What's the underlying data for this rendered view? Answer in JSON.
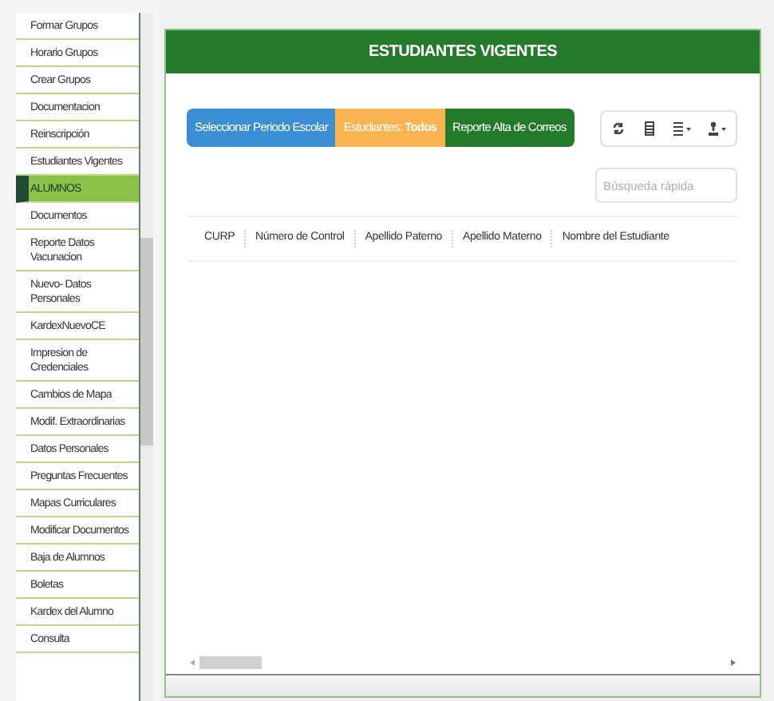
{
  "sidebar": {
    "items": [
      {
        "label": "Formar Grupos",
        "selected": false
      },
      {
        "label": "Horario Grupos",
        "selected": false
      },
      {
        "label": "Crear Grupos",
        "selected": false
      },
      {
        "label": "Documentacion",
        "selected": false
      },
      {
        "label": "Reinscripción",
        "selected": false
      },
      {
        "label": "Estudiantes Vigentes",
        "selected": false
      },
      {
        "label": "ALUMNOS",
        "selected": true
      },
      {
        "label": "Documentos",
        "selected": false
      },
      {
        "label": "Reporte Datos Vacunacion",
        "selected": false
      },
      {
        "label": "Nuevo- Datos Personales",
        "selected": false
      },
      {
        "label": "KardexNuevoCE",
        "selected": false
      },
      {
        "label": "Impresion de Credenciales",
        "selected": false
      },
      {
        "label": "Cambios de Mapa",
        "selected": false
      },
      {
        "label": "Modif. Extraordinarias",
        "selected": false
      },
      {
        "label": "Datos Personales",
        "selected": false
      },
      {
        "label": "Preguntas Frecuentes",
        "selected": false
      },
      {
        "label": "Mapas Curriculares",
        "selected": false
      },
      {
        "label": "Modificar Documentos",
        "selected": false
      },
      {
        "label": "Baja de Alumnos",
        "selected": false
      },
      {
        "label": "Boletas",
        "selected": false
      },
      {
        "label": "Kardex del Alumno",
        "selected": false
      },
      {
        "label": "Consulta",
        "selected": false
      }
    ]
  },
  "panel": {
    "title": "ESTUDIANTES VIGENTES",
    "buttons": [
      {
        "kind": "primary",
        "label": "Seleccionar Periodo Escolar"
      },
      {
        "kind": "warning",
        "label": "Estudiantes: **Todos**"
      },
      {
        "kind": "success",
        "label": "Reporte Alta de Correos"
      }
    ],
    "search": {
      "placeholder": "Búsqueda rápida"
    },
    "table": {
      "columns": [
        "CURP",
        "Número de Control",
        "Apellido Paterno",
        "Apellido Materno",
        "Nombre del Estudiante"
      ]
    }
  }
}
